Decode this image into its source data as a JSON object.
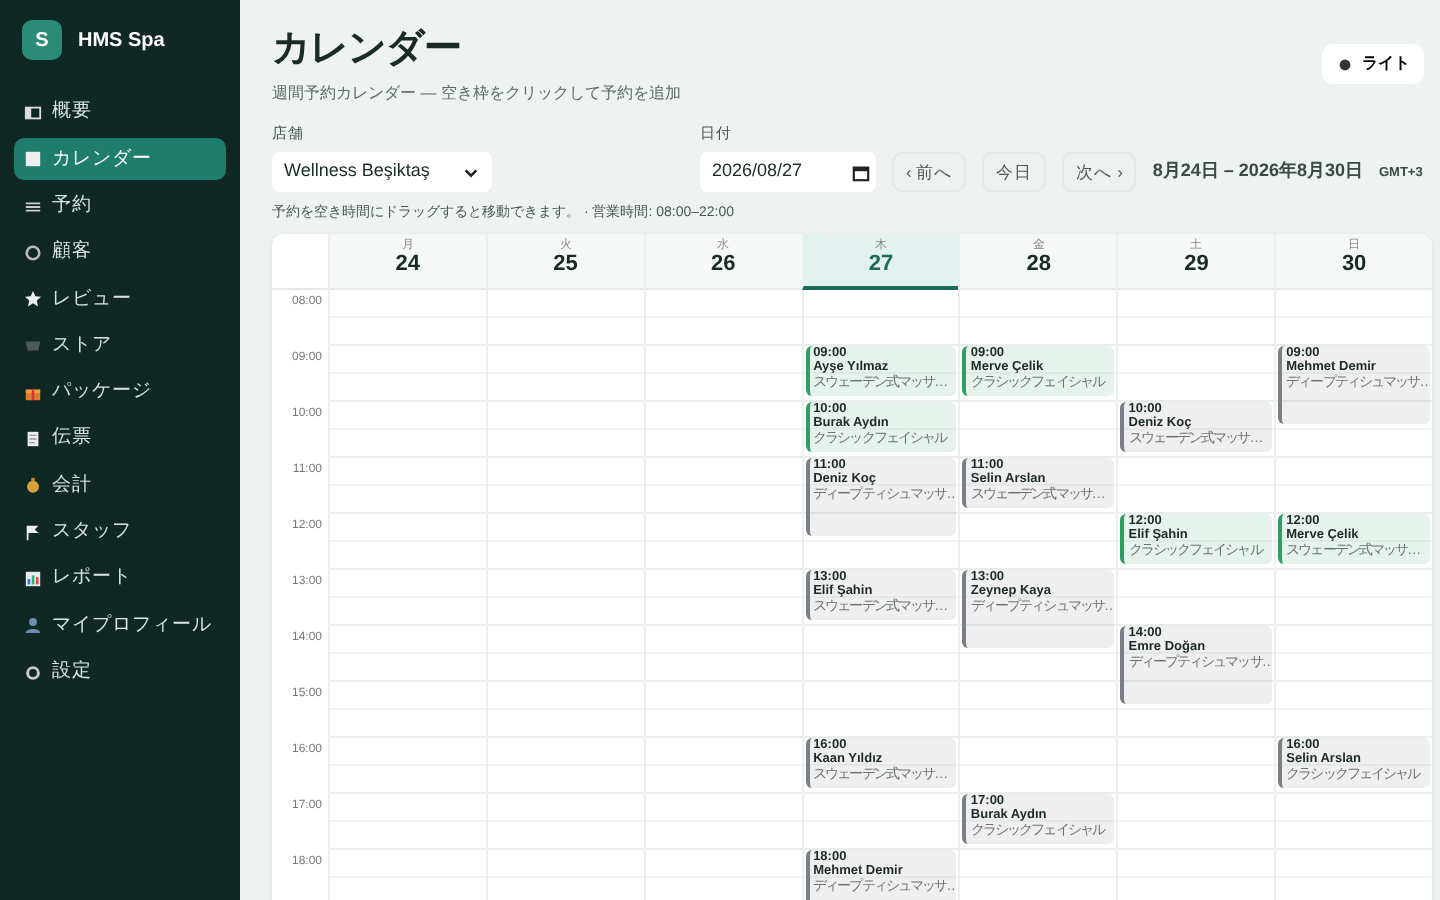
{
  "sidebar": {
    "brand": {
      "logo": "S",
      "name": "HMS Spa"
    },
    "items": [
      {
        "label": "概要",
        "selected": false
      },
      {
        "label": "カレンダー",
        "selected": true
      },
      {
        "label": "予約",
        "selected": false
      },
      {
        "label": "顧客",
        "selected": false
      },
      {
        "label": "レビュー",
        "selected": false
      },
      {
        "label": "ストア",
        "selected": false
      },
      {
        "label": "パッケージ",
        "selected": false
      },
      {
        "label": "伝票",
        "selected": false
      },
      {
        "label": "会計",
        "selected": false
      },
      {
        "label": "スタッフ",
        "selected": false
      },
      {
        "label": "レポート",
        "selected": false
      },
      {
        "label": "マイプロフィール",
        "selected": false
      },
      {
        "label": "設定",
        "selected": false
      }
    ]
  },
  "header": {
    "title": "カレンダー",
    "subtitle": "週間予約カレンダー — 空き枠をクリックして予約を追加",
    "theme_button": "ライト"
  },
  "filters": {
    "store": {
      "label": "店舗",
      "value": "Wellness Beşiktaş"
    },
    "date": {
      "label": "日付",
      "value": "2026/08/27"
    },
    "buttons": [
      "‹ 前へ",
      "今日",
      "次へ ›"
    ],
    "range": "8月24日 – 2026年8月30日",
    "timezone": "GMT+3"
  },
  "hint": "予約を空き時間にドラッグすると移動できます。 · 営業時間: 08:00–22:00",
  "calendar": {
    "hours": [
      "08:00",
      "09:00",
      "10:00",
      "11:00",
      "12:00",
      "13:00",
      "14:00",
      "15:00",
      "16:00",
      "17:00",
      "18:00"
    ],
    "days": [
      {
        "weekday": "月",
        "date": "24",
        "selected": false
      },
      {
        "weekday": "火",
        "date": "25",
        "selected": false
      },
      {
        "weekday": "水",
        "date": "26",
        "selected": false
      },
      {
        "weekday": "木",
        "date": "27",
        "selected": true,
        "events": [
          {
            "time": "09:00",
            "client": "Ayşe Yılmaz",
            "service": "スウェーデン式マッサ…",
            "kind": "hour",
            "color": "#2f9e63"
          },
          {
            "time": "10:00",
            "client": "Burak Aydın",
            "service": "クラシックフェイシャル",
            "kind": "hour",
            "color": "#2f9e63"
          },
          {
            "time": "11:00",
            "client": "Deniz Koç",
            "service": "ディープティシュマッサ…",
            "kind": "long",
            "color": "#7a7f85"
          },
          {
            "time": "13:00",
            "client": "Elif Şahin",
            "service": "スウェーデン式マッサ…",
            "kind": "hour",
            "color": "#7a7f85"
          },
          {
            "time": "16:00",
            "client": "Kaan Yıldız",
            "service": "スウェーデン式マッサ…",
            "kind": "hour",
            "color": "#7a7f85"
          },
          {
            "time": "18:00",
            "client": "Mehmet Demir",
            "service": "ディープティシュマッサ…",
            "kind": "long",
            "color": "#7a7f85"
          }
        ]
      },
      {
        "weekday": "金",
        "date": "28",
        "selected": false,
        "events": [
          {
            "time": "09:00",
            "client": "Merve Çelik",
            "service": "クラシックフェイシャル",
            "kind": "hour",
            "color": "#2f9e63"
          },
          {
            "time": "11:00",
            "client": "Selin Arslan",
            "service": "スウェーデン式マッサ…",
            "kind": "hour",
            "color": "#7a7f85"
          },
          {
            "time": "13:00",
            "client": "Zeynep Kaya",
            "service": "ディープティシュマッサ…",
            "kind": "long",
            "color": "#7a7f85"
          },
          {
            "time": "17:00",
            "client": "Burak Aydın",
            "service": "クラシックフェイシャル",
            "kind": "hour",
            "color": "#7a7f85"
          }
        ]
      },
      {
        "weekday": "土",
        "date": "29",
        "selected": false,
        "events": [
          {
            "time": "10:00",
            "client": "Deniz Koç",
            "service": "スウェーデン式マッサ…",
            "kind": "hour",
            "color": "#7a7f85"
          },
          {
            "time": "12:00",
            "client": "Elif Şahin",
            "service": "クラシックフェイシャル",
            "kind": "hour",
            "color": "#2f9e63"
          },
          {
            "time": "14:00",
            "client": "Emre Doğan",
            "service": "ディープティシュマッサ…",
            "kind": "long",
            "color": "#7a7f85"
          }
        ]
      },
      {
        "weekday": "日",
        "date": "30",
        "selected": false,
        "events": [
          {
            "time": "09:00",
            "client": "Mehmet Demir",
            "service": "ディープティシュマッサ…",
            "kind": "long",
            "color": "#7a7f85"
          },
          {
            "time": "12:00",
            "client": "Merve Çelik",
            "service": "スウェーデン式マッサ…",
            "kind": "hour",
            "color": "#2f9e63"
          },
          {
            "time": "16:00",
            "client": "Selin Arslan",
            "service": "クラシックフェイシャル",
            "kind": "hour",
            "color": "#7a7f85"
          }
        ]
      }
    ]
  }
}
